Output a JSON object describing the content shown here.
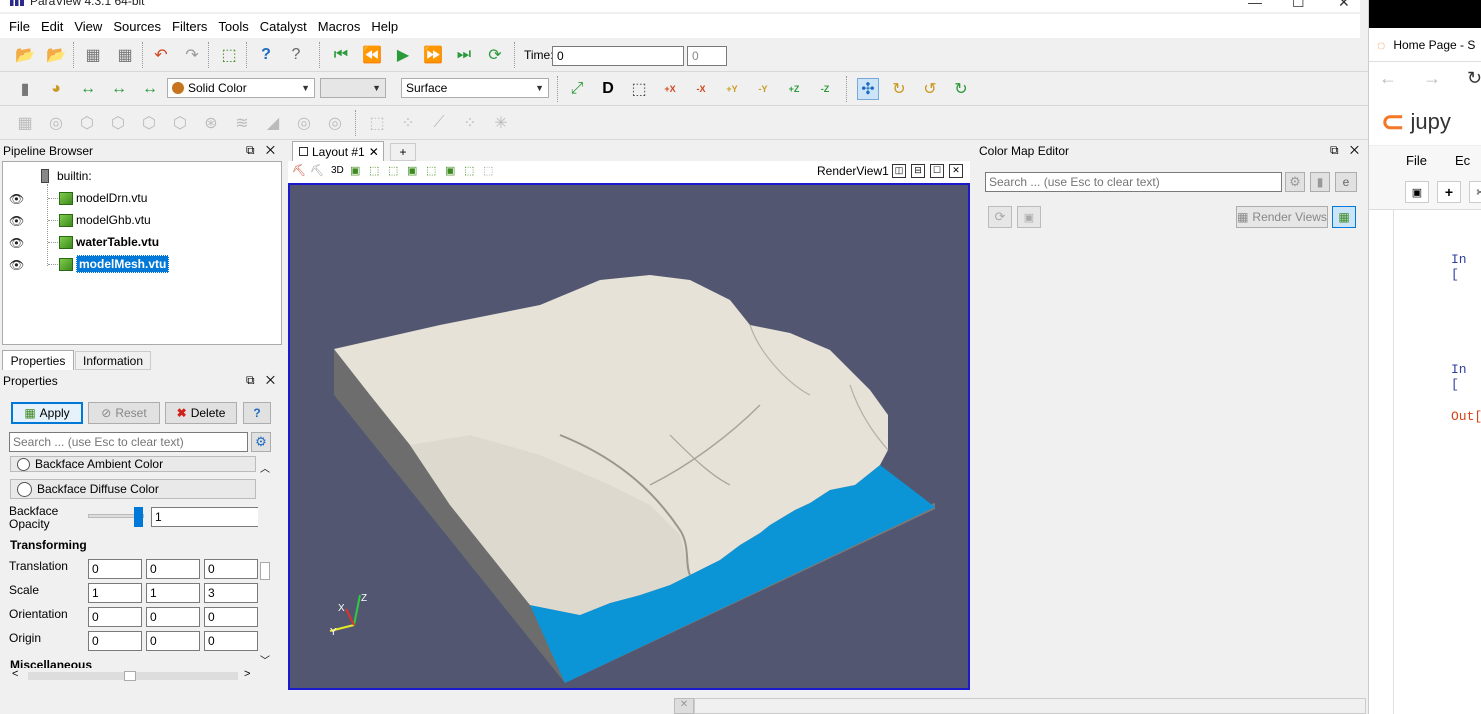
{
  "window": {
    "title": "ParaView 4.3.1 64-bit"
  },
  "menu": [
    "File",
    "Edit",
    "View",
    "Sources",
    "Filters",
    "Tools",
    "Catalyst",
    "Macros",
    "Help"
  ],
  "toolbar1": {
    "time_label": "Time:",
    "time_value": "0",
    "timestep_value": "0"
  },
  "toolbar2": {
    "color_by": "Solid Color",
    "representation": "Surface",
    "axis_buttons": [
      "+X",
      "-X",
      "+Y",
      "-Y",
      "+Z",
      "-Z"
    ]
  },
  "pipeline_browser": {
    "title": "Pipeline Browser",
    "root": "builtin:",
    "items": [
      {
        "name": "modelDrn.vtu",
        "visible": true,
        "bold": false,
        "selected": false
      },
      {
        "name": "modelGhb.vtu",
        "visible": true,
        "bold": false,
        "selected": false
      },
      {
        "name": "waterTable.vtu",
        "visible": true,
        "bold": true,
        "selected": false
      },
      {
        "name": "modelMesh.vtu",
        "visible": true,
        "bold": true,
        "selected": true
      }
    ]
  },
  "tabs": {
    "properties": "Properties",
    "information": "Information"
  },
  "properties": {
    "title": "Properties",
    "apply": "Apply",
    "reset": "Reset",
    "delete": "Delete",
    "help": "?",
    "search_placeholder": "Search ... (use Esc to clear text)",
    "backface_ambient": "Backface Ambient Color",
    "backface_diffuse": "Backface Diffuse Color",
    "backface_opacity_label_1": "Backface",
    "backface_opacity_label_2": "Opacity",
    "backface_opacity": "1",
    "backface_opacity_level": 1.0,
    "transforming": "Transforming",
    "translation_label": "Translation",
    "translation": [
      "0",
      "0",
      "0"
    ],
    "scale_label": "Scale",
    "scale": [
      "1",
      "1",
      "3"
    ],
    "orientation_label": "Orientation",
    "orientation": [
      "0",
      "0",
      "0"
    ],
    "origin_label": "Origin",
    "origin": [
      "0",
      "0",
      "0"
    ],
    "miscellaneous": "Miscellaneous"
  },
  "layout": {
    "tab_label": "Layout #1",
    "add_tab": "+",
    "view_3d": "3D",
    "render_view": "RenderView1",
    "axes": {
      "x": "X",
      "y": "Y",
      "z": "Z"
    },
    "colors": {
      "background": "#525670",
      "terrain": "#e6e2d8",
      "water": "#0b94d6",
      "border": "#1a1acc"
    }
  },
  "color_map_editor": {
    "title": "Color Map Editor",
    "search_placeholder": "Search ... (use Esc to clear text)",
    "render_views": "Render Views"
  },
  "browser": {
    "tab_title": "Home Page - S",
    "app_name": "jupy",
    "menu_file": "File",
    "menu_edit": "Ec",
    "cells": [
      "In [",
      "In [",
      "Out["
    ]
  }
}
